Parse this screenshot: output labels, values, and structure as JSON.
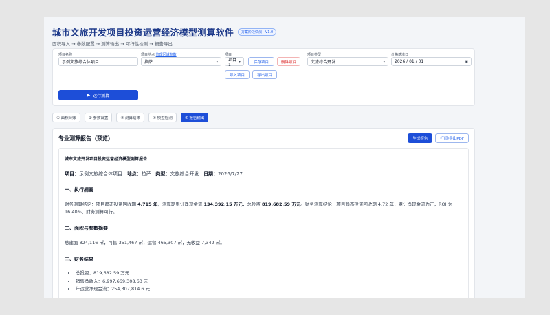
{
  "app": {
    "title": "城市文旅开发项目投资运营经济模型测算软件",
    "version": "方案阶段快测 · V1.0",
    "subtitle": "面积导入 → 参数配置 → 测算输出 → 可行性检测 → 报告导出"
  },
  "form": {
    "project_name": {
      "label": "项目名称",
      "value": "示例文旅综合体项目"
    },
    "location": {
      "label": "项目地点",
      "link": "管理区域参数",
      "value": "拉萨"
    },
    "project": {
      "label": "项目",
      "value": "项目1"
    },
    "project_type": {
      "label": "项目类型",
      "value": "文旅综合开发"
    },
    "base_date": {
      "label": "价格基准日",
      "value": "2026 / 01 / 01"
    },
    "save_button": "保存项目",
    "delete_button": "删除项目",
    "import_button": "导入项目",
    "export_button": "导出项目",
    "run_button": "运行测算"
  },
  "tabs": [
    {
      "label": "① 面积台账"
    },
    {
      "label": "② 参数设置"
    },
    {
      "label": "③ 测算结果"
    },
    {
      "label": "④ 模型检测"
    },
    {
      "label": "⑤ 报告输出"
    }
  ],
  "report": {
    "heading": "专业测算报告（预览）",
    "generate_button": "生成报告",
    "print_button": "打印/导出PDF",
    "doc_title": "城市文旅开发项目投资运营经济模型测算报告",
    "meta": {
      "project_key": "项目：",
      "project_val": "示例文旅综合体项目",
      "location_key": "地点：",
      "location_val": "拉萨",
      "type_key": "类型：",
      "type_val": "文旅综合开发",
      "date_key": "日期：",
      "date_val": "2026/7/27"
    },
    "sec1": "一、执行摘要",
    "summary": {
      "p1": "财务测算结论：项目静态投资回收期 ",
      "v1": "4.715 年",
      "p2": "，测算期累计净现金流 ",
      "v2": "134,392.15 万元",
      "p3": "，总投资 ",
      "v3": "819,682.59 万元",
      "p4": "。财务测算结论：项目静态投资回收期 4.72 年，累计净现金流为正，ROI 为 16.40%，财务测算可行。"
    },
    "sec2": "二、面积与参数摘要",
    "area_text": "总建面 824,116 ㎡，可售 351,467 ㎡，运营 465,307 ㎡，无收益 7,342 ㎡。",
    "sec3": "三、财务结果",
    "results": [
      "总投资：819,682.59 万元",
      "销售净收入：6,997,669,308.63 元",
      "年运营净现金流：254,307,814.6 元"
    ]
  }
}
